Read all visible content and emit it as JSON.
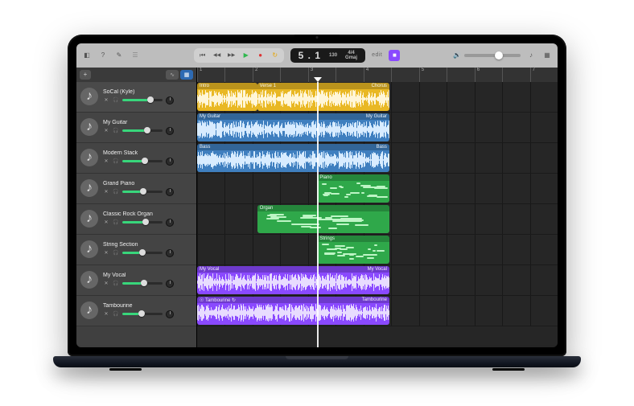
{
  "transport": {
    "position": "5 . 1",
    "tempo": "130",
    "time_sig": "4/4",
    "key": "Gmaj",
    "edit_label": "edit"
  },
  "master_volume": 0.62,
  "colors": {
    "audio_yellow": "#e9b824",
    "audio_blue": "#3f7fbf",
    "midi_green": "#2fa84a",
    "audio_purple": "#8a49ff",
    "wave_light": "#fff6d8",
    "wave_blue_l": "#d8ecff",
    "wave_purple_l": "#e8dcff",
    "midi_note": "#bdf5c5",
    "track_green": "#38d67b"
  },
  "ruler": {
    "bars": [
      "1",
      "",
      "2",
      "",
      "3",
      "",
      "4",
      "",
      "5",
      "",
      "6",
      "",
      "7"
    ]
  },
  "playhead_bar": 5.0,
  "tracks": [
    {
      "name": "SoCal (Kyle)",
      "icon": "user-icon",
      "volume": 0.7,
      "color_key": "track_green"
    },
    {
      "name": "My Guitar",
      "icon": "guitar-icon",
      "volume": 0.62,
      "color_key": "track_green"
    },
    {
      "name": "Modern Stack",
      "icon": "keys-icon",
      "volume": 0.55,
      "color_key": "track_green"
    },
    {
      "name": "Grand Piano",
      "icon": "piano-icon",
      "volume": 0.52,
      "color_key": "track_green"
    },
    {
      "name": "Classic Rock Organ",
      "icon": "organ-icon",
      "volume": 0.58,
      "color_key": "track_green"
    },
    {
      "name": "String Section",
      "icon": "strings-icon",
      "volume": 0.5,
      "color_key": "track_green"
    },
    {
      "name": "My Vocal",
      "icon": "mic-icon",
      "volume": 0.53,
      "color_key": "track_green"
    },
    {
      "name": "Tambourine",
      "icon": "tamb-icon",
      "volume": 0.48,
      "color_key": "track_green"
    }
  ],
  "regions": [
    {
      "track": 0,
      "type": "audio",
      "color": "audio_yellow",
      "start": 1.0,
      "end": 3.0,
      "label": "Intro",
      "wave": "wave_light"
    },
    {
      "track": 0,
      "type": "audio",
      "color": "audio_yellow",
      "start": 3.0,
      "end": 7.4,
      "label": "Verse 1",
      "label_r": "Chorus",
      "wave": "wave_light"
    },
    {
      "track": 1,
      "type": "audio",
      "color": "audio_blue",
      "start": 1.0,
      "end": 7.4,
      "label": "My Guitar",
      "label_r": "My Guitar",
      "wave": "wave_blue_l"
    },
    {
      "track": 2,
      "type": "audio",
      "color": "audio_blue",
      "start": 1.0,
      "end": 7.4,
      "label": "Bass",
      "label_r": "Bass",
      "wave": "wave_blue_l"
    },
    {
      "track": 3,
      "type": "midi",
      "color": "midi_green",
      "start": 5.0,
      "end": 7.4,
      "label": "Piano"
    },
    {
      "track": 4,
      "type": "midi",
      "color": "midi_green",
      "start": 3.0,
      "end": 7.4,
      "label": "Organ"
    },
    {
      "track": 5,
      "type": "midi",
      "color": "midi_green",
      "start": 5.0,
      "end": 7.4,
      "label": "Strings"
    },
    {
      "track": 6,
      "type": "audio",
      "color": "audio_purple",
      "start": 1.0,
      "end": 7.4,
      "label": "My Vocal",
      "label_r": "My Vocal",
      "wave": "wave_purple_l"
    },
    {
      "track": 7,
      "type": "audio",
      "color": "audio_purple",
      "start": 1.0,
      "end": 7.4,
      "label": "☉ Tambourine  ↻",
      "label_r": "Tambourine",
      "wave": "wave_purple_l"
    }
  ],
  "icons": {
    "library": "◧",
    "quicktips": "?",
    "editors": "✎",
    "mixer": "☰",
    "rewind_full": "⏮",
    "rewind": "◀◀",
    "fastfwd": "▶▶",
    "play": "▶",
    "record": "●",
    "cycle": "↻",
    "key": "♪",
    "stop": "■",
    "speaker": "🔊",
    "mute": "✕",
    "headphone": "🎧",
    "plus": "+",
    "waveform": "∿",
    "grid": "▦"
  }
}
